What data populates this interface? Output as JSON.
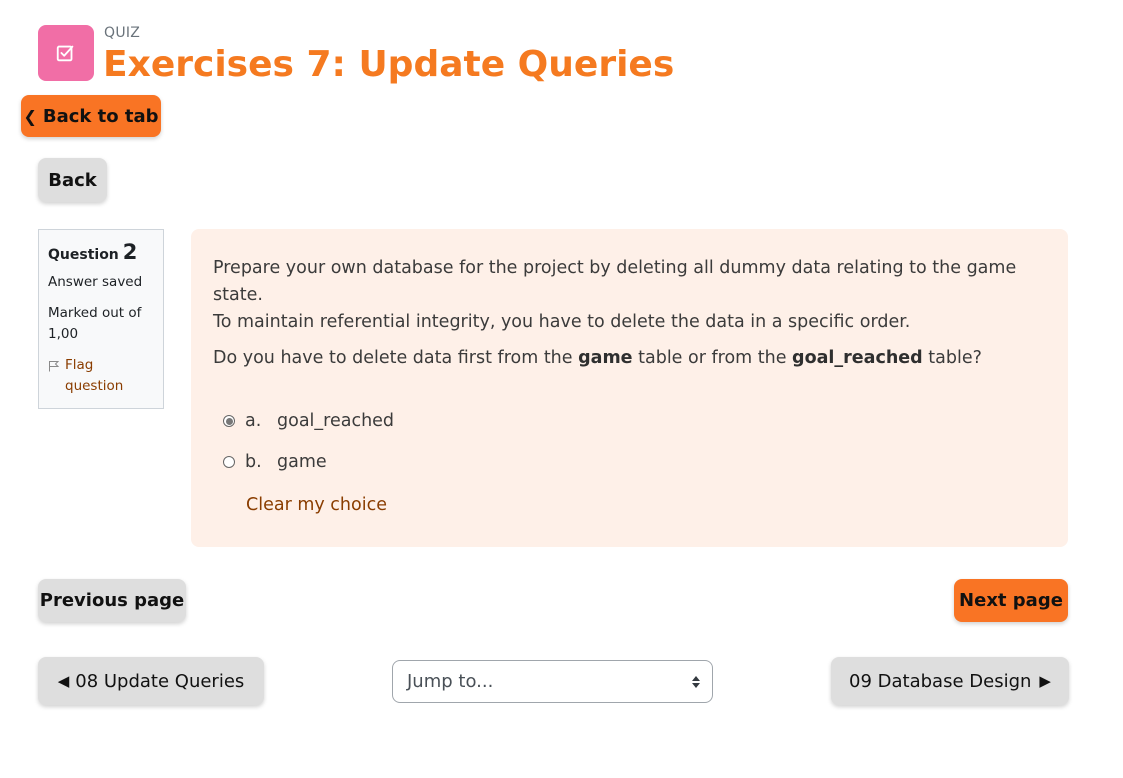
{
  "header": {
    "activity_kind": "QUIZ",
    "title": "Exercises 7: Update Queries",
    "icon": "quiz-checkbox-icon",
    "icon_bg": "#f16ea6",
    "title_color": "#f57a20"
  },
  "nav": {
    "back_to_tab_label": "Back to tab",
    "back_label": "Back"
  },
  "question_info": {
    "label": "Question",
    "number": "2",
    "state": "Answer saved",
    "grade": "Marked out of 1,00",
    "flag_label": "Flag question"
  },
  "question": {
    "line1": "Prepare your own database for the project by deleting all dummy data relating to the game state.",
    "line2": "To maintain referential integrity, you have to delete the data in a specific order.",
    "q_part1": "Do you have to delete data first from the ",
    "q_bold1": "game",
    "q_part2": " table or from the ",
    "q_bold2": "goal_reached",
    "q_part3": " table?",
    "answers": [
      {
        "letter": "a.",
        "text": "goal_reached",
        "selected": true
      },
      {
        "letter": "b.",
        "text": "game",
        "selected": false
      }
    ],
    "clear_label": "Clear my choice",
    "bg_color": "#fef0e8"
  },
  "page_nav": {
    "previous_label": "Previous page",
    "next_label": "Next page"
  },
  "activity_nav": {
    "previous_label": "08 Update Queries",
    "jump_placeholder": "Jump to...",
    "next_label": "09 Database Design"
  },
  "colors": {
    "accent": "#f97424",
    "link": "#8a3d00"
  }
}
